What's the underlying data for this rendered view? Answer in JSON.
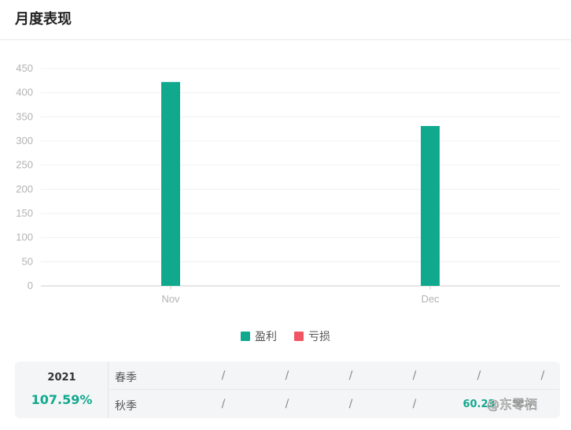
{
  "page": {
    "title": "月度表现"
  },
  "chart_data": {
    "type": "bar",
    "categories": [
      "Nov",
      "Dec"
    ],
    "series": [
      {
        "name": "盈利",
        "color": "#11a98e",
        "values": [
          422,
          331
        ]
      },
      {
        "name": "亏损",
        "color": "#ef5563",
        "values": [
          0,
          0
        ]
      }
    ],
    "ylim": [
      0,
      450
    ],
    "yticks": [
      0,
      50,
      100,
      150,
      200,
      250,
      300,
      350,
      400,
      450
    ],
    "grid": true,
    "legend_position": "bottom-center"
  },
  "summary": {
    "year": "2021",
    "year_return": "107.59%",
    "rows": [
      {
        "label": "春季",
        "cells": [
          "/",
          "/",
          "/",
          "/",
          "/",
          "/"
        ]
      },
      {
        "label": "秋季",
        "cells": [
          "/",
          "/",
          "/",
          "/",
          "60.23",
          ""
        ]
      }
    ],
    "watermark": "@东零栖"
  }
}
